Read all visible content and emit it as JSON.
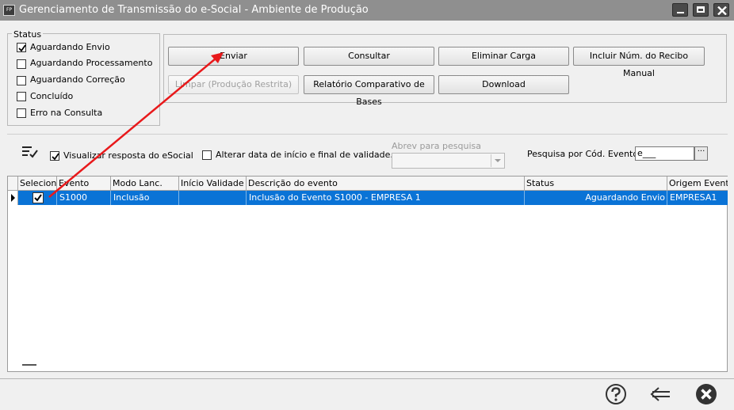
{
  "window": {
    "icon_text": "FP",
    "title": "Gerenciamento de Transmissão do e-Social - Ambiente de Produção"
  },
  "status_group": {
    "title": "Status",
    "items": [
      {
        "label": "Aguardando Envio",
        "checked": true
      },
      {
        "label": "Aguardando Processamento",
        "checked": false
      },
      {
        "label": "Aguardando Correção",
        "checked": false
      },
      {
        "label": "Concluído",
        "checked": false
      },
      {
        "label": "Erro na Consulta",
        "checked": false
      }
    ]
  },
  "actions": {
    "enviar": "Enviar",
    "consultar": "Consultar",
    "eliminar_carga": "Eliminar Carga",
    "incluir_recibo": "Incluir Núm. do Recibo Manual",
    "limpar": "Limpar (Produção Restrita)",
    "relatorio": "Relatório Comparativo de Bases",
    "download": "Download"
  },
  "filters": {
    "visualizar_label": "Visualizar resposta do eSocial",
    "visualizar_checked": true,
    "alterar_label": "Alterar data de início e final de validade.",
    "alterar_checked": false,
    "abrev_label": "Abrev para pesquisa",
    "abrev_value": "",
    "pesquisa_label": "Pesquisa por Cód. Evento:",
    "pesquisa_value": "e___",
    "pesquisa_button": "···"
  },
  "grid": {
    "columns": [
      "Seleciona",
      "Evento",
      "Modo Lanc.",
      "Início Validade",
      "Descrição do evento",
      "Status",
      "Origem Evento"
    ],
    "rows": [
      {
        "seleciona": true,
        "evento": "S1000",
        "modo_lanc": "Inclusão",
        "inicio_validade": "",
        "descricao": "Inclusão do Evento S1000 - EMPRESA 1",
        "status": "Aguardando Envio",
        "origem": "EMPRESA1"
      }
    ]
  },
  "footer_icons": [
    "help-icon",
    "back-arrow-icon",
    "close-circle-icon"
  ],
  "colors": {
    "titlebar": "#8f8f8f",
    "selection": "#0a73d6",
    "annotation_arrow": "#e8191b"
  }
}
